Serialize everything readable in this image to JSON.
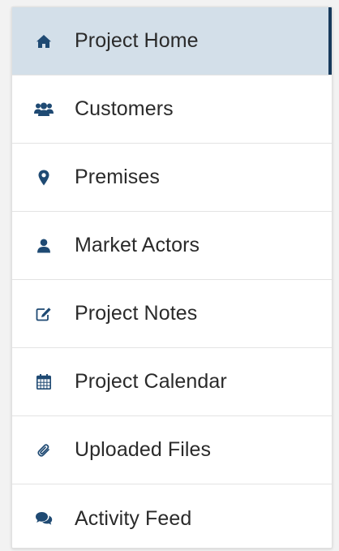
{
  "sidebar": {
    "items": [
      {
        "label": "Project Home",
        "icon": "home-icon",
        "active": true
      },
      {
        "label": "Customers",
        "icon": "users-icon",
        "active": false
      },
      {
        "label": "Premises",
        "icon": "map-marker-icon",
        "active": false
      },
      {
        "label": "Market Actors",
        "icon": "user-icon",
        "active": false
      },
      {
        "label": "Project Notes",
        "icon": "edit-icon",
        "active": false
      },
      {
        "label": "Project Calendar",
        "icon": "calendar-icon",
        "active": false
      },
      {
        "label": "Uploaded Files",
        "icon": "paperclip-icon",
        "active": false
      },
      {
        "label": "Activity Feed",
        "icon": "comments-icon",
        "active": false
      }
    ]
  },
  "colors": {
    "icon": "#1f4a73",
    "active_bg": "#d3dfe9",
    "active_bar": "#173a5c",
    "text": "#2a2a2a"
  }
}
